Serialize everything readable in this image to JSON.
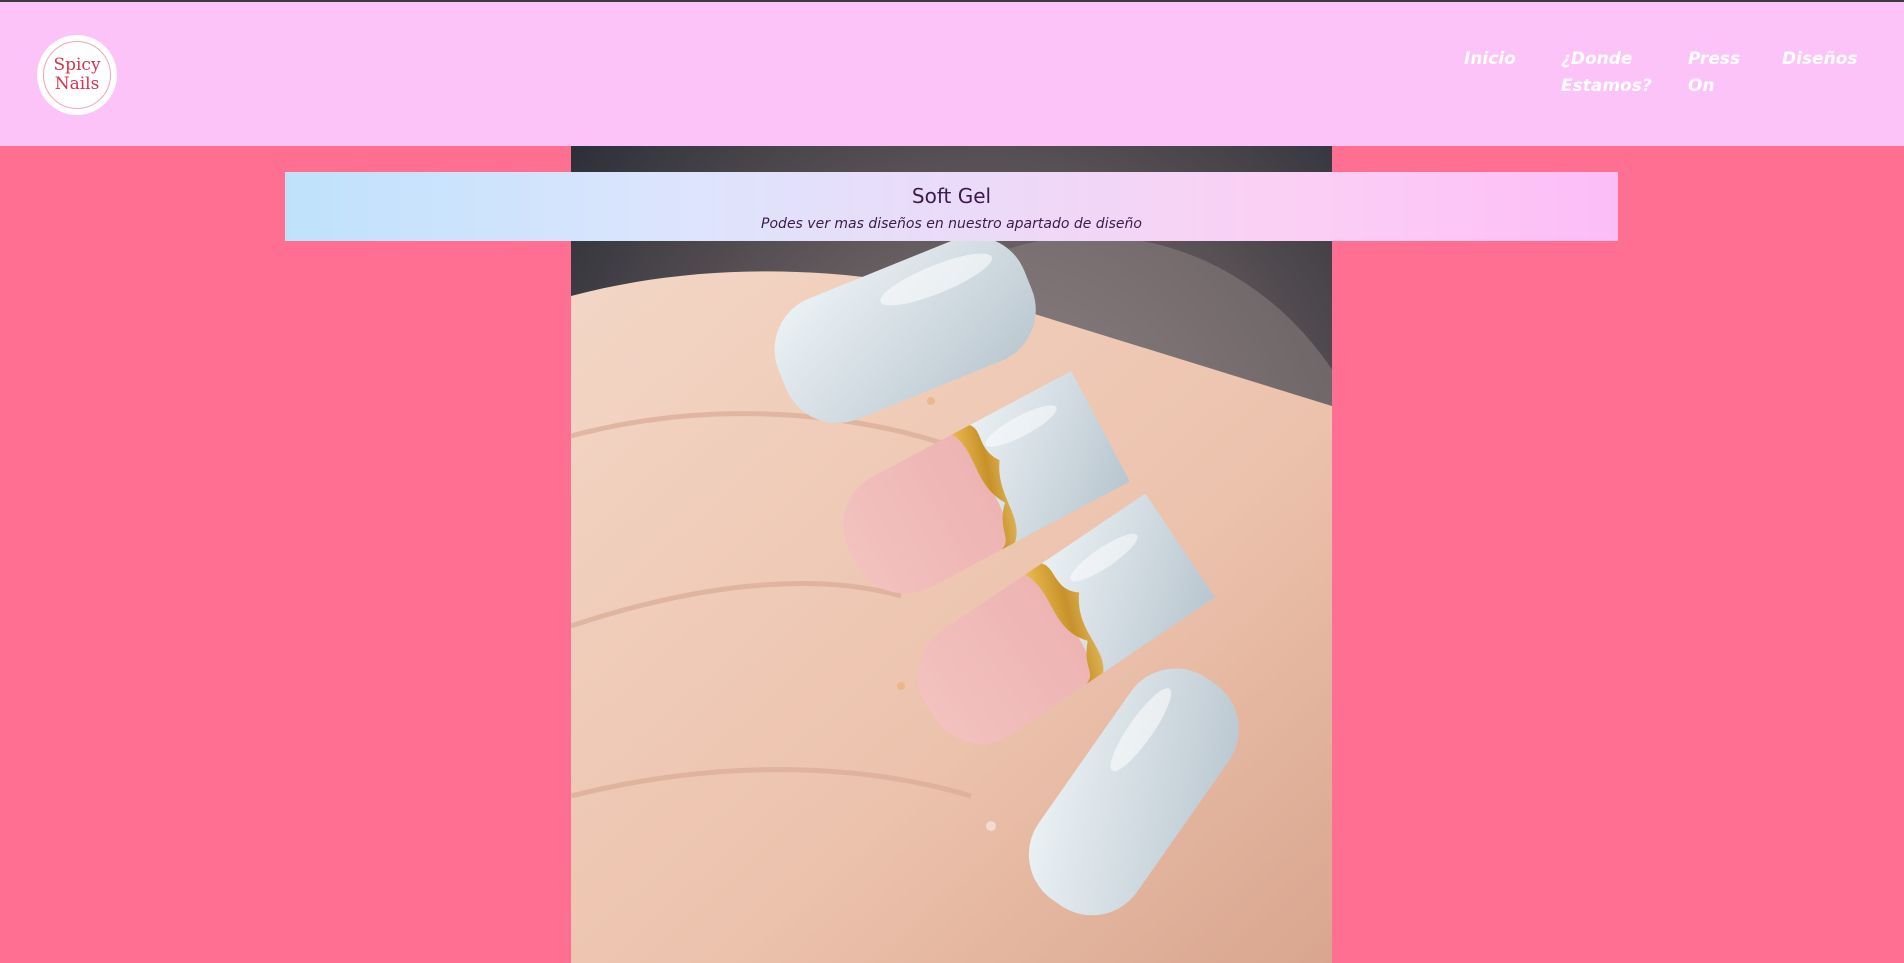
{
  "brand": {
    "logo_text": "Spicy Nails"
  },
  "nav": {
    "items": [
      {
        "label": "Inicio"
      },
      {
        "label": "¿Donde Estamos?"
      },
      {
        "label": "Press On"
      },
      {
        "label": "Diseños"
      }
    ]
  },
  "banner": {
    "title": "Soft Gel",
    "subtitle": "Podes ver mas diseños en nuestro apartado de diseño"
  },
  "colors": {
    "page_background": "#fe6f91",
    "header_background": "#fbc3f7",
    "nav_text": "#ffffff",
    "banner_text": "#3b1b4a",
    "logo_text": "#d8324e"
  },
  "hero": {
    "subject": "nail-photo"
  }
}
